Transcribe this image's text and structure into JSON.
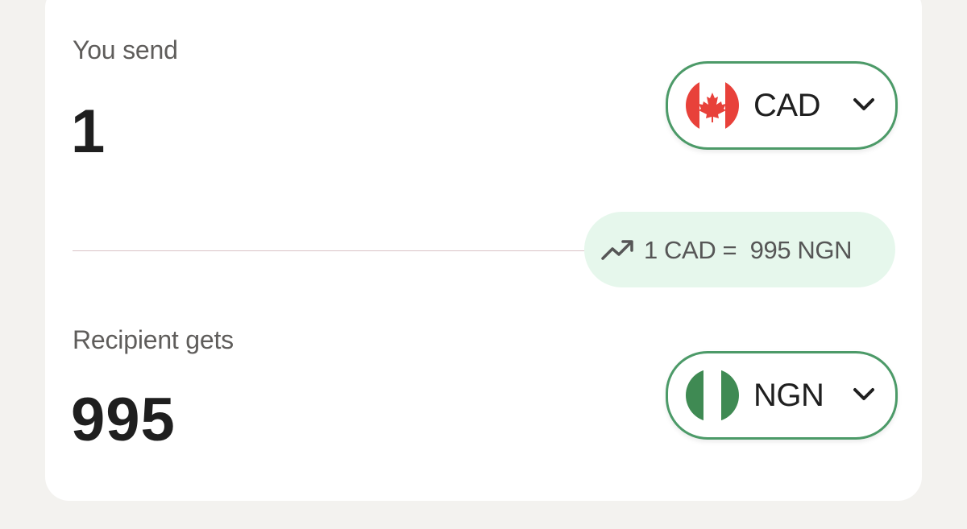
{
  "send": {
    "label": "You send",
    "amount": "1",
    "currency": {
      "code": "CAD",
      "flag_icon": "canada-flag-icon",
      "dropdown_icon": "chevron-down-icon"
    }
  },
  "rate": {
    "icon": "trending-up-icon",
    "text": "1 CAD =  995 NGN"
  },
  "receive": {
    "label": "Recipient gets",
    "amount": "995",
    "currency": {
      "code": "NGN",
      "flag_icon": "nigeria-flag-icon",
      "dropdown_icon": "chevron-down-icon"
    }
  },
  "colors": {
    "accent_green": "#4c9a68",
    "rate_bg": "#e6f7ec",
    "canada_red": "#e8413a",
    "nigeria_green": "#3f8a53"
  }
}
